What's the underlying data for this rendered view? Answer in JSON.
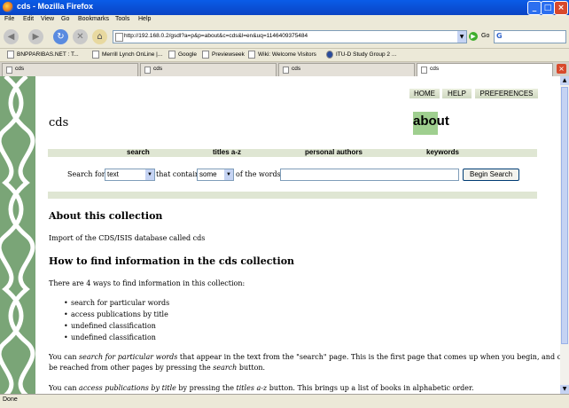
{
  "window": {
    "title": "cds - Mozilla Firefox"
  },
  "menu": [
    "File",
    "Edit",
    "View",
    "Go",
    "Bookmarks",
    "Tools",
    "Help"
  ],
  "address": {
    "url": "http://192.168.0.2/gsdl?a=p&p=about&c=cds&l=en&uq=1146409375484",
    "go_label": "Go"
  },
  "bookmarks": [
    "BNPPARIBAS.NET : T...",
    "Merrill Lynch OnLine |...",
    "Google",
    "Previewseek",
    "Wiki: Welcome Visitors",
    "ITU-D Study Group 2 ..."
  ],
  "tabs": [
    "cds",
    "cds",
    "cds",
    "cds"
  ],
  "page": {
    "top_nav": {
      "home": "HOME",
      "help": "HELP",
      "preferences": "PREFERENCES"
    },
    "collection_title": "cds",
    "about_label": "about",
    "nav": {
      "search": "search",
      "titles": "titles a-z",
      "authors": "personal authors",
      "keywords": "keywords"
    },
    "search": {
      "search_for": "Search for",
      "field_value": "text",
      "that_contain": "that contain",
      "mode_value": "some",
      "of_the_words": "of the words",
      "button": "Begin Search"
    },
    "about_heading": "About this collection",
    "about_text": "Import of the CDS/ISIS database called cds",
    "howto_heading": "How to find information in the cds collection",
    "ways_text": "There are 4 ways to find information in this collection:",
    "ways": [
      "search for particular words",
      "access publications by title",
      "undefined classification",
      "undefined classification"
    ],
    "para1": {
      "l1_a": "You can ",
      "l1_b": "search for particular words",
      "l1_c": " that appear in the text from the \"search\" page. This is the first page that comes up when you begin, and can",
      "l2_a": "be reached from other pages by pressing the ",
      "l2_b": "search",
      "l2_c": " button."
    },
    "para2": {
      "a": "You can ",
      "b": "access publications by title",
      "c": " by pressing the ",
      "d": "titles a-z",
      "e": " button. This brings up a list of books in alphabetic order."
    }
  },
  "status": "Done"
}
